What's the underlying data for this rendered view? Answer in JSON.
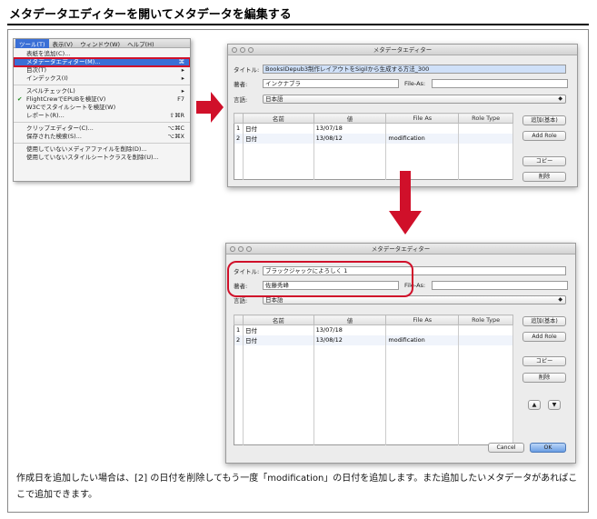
{
  "page_title": "メタデータエディターを開いてメタデータを編集する",
  "menu": {
    "bar": [
      "ツール(T)",
      "表示(V)",
      "ウィンドウ(W)",
      "ヘルプ(H)"
    ],
    "items": [
      {
        "label": "表紙を追加(C)...",
        "shortcut": ""
      },
      {
        "label": "メタデータエディター(M)...",
        "shortcut": "⌘"
      },
      {
        "label": "目次(T)",
        "shortcut": "▸"
      },
      {
        "label": "インデックス(I)",
        "shortcut": "▸"
      },
      {
        "label": "スペルチェック(L)",
        "shortcut": "▸"
      },
      {
        "label": "FlightCrewでEPUBを検証(V)",
        "shortcut": "F7"
      },
      {
        "label": "W3Cでスタイルシートを検証(W)",
        "shortcut": ""
      },
      {
        "label": "レポート(R)...",
        "shortcut": "⇧⌘R"
      },
      {
        "label": "クリップエディター(C)...",
        "shortcut": "⌥⌘C"
      },
      {
        "label": "保存された検索(S)...",
        "shortcut": "⌥⌘X"
      },
      {
        "label": "使用していないメディアファイルを削除(D)...",
        "shortcut": ""
      },
      {
        "label": "使用していないスタイルシートクラスを削除(U)...",
        "shortcut": ""
      }
    ]
  },
  "dialog1": {
    "title": "メタデータエディター",
    "title_label": "タイトル:",
    "title_value": "BooksIDepub3制作レイアウトをSigilから生成する方法_300",
    "author_label": "著者:",
    "author_value": "インクナブラ",
    "fileas_label": "File-As:",
    "fileas_value": "",
    "language_label": "言語:",
    "language_value": "日本語",
    "columns": [
      "名前",
      "値",
      "File As",
      "Role Type"
    ],
    "rows": [
      {
        "num": "1",
        "name": "日付",
        "value": "13/07/18",
        "fileas": "",
        "role": ""
      },
      {
        "num": "2",
        "name": "日付",
        "value": "13/08/12",
        "fileas": "modification",
        "role": ""
      }
    ],
    "buttons": {
      "add_basic": "追加(基本)",
      "add_role": "Add Role",
      "copy": "コピー",
      "delete": "削除"
    }
  },
  "dialog2": {
    "title": "メタデータエディター",
    "title_label": "タイトル:",
    "title_value": "ブラックジャックによろしく 1",
    "author_label": "著者:",
    "author_value": "佐藤秀峰",
    "fileas_label": "File-As:",
    "fileas_value": "",
    "language_label": "言語:",
    "language_value": "日本語",
    "columns": [
      "名前",
      "値",
      "File As",
      "Role Type"
    ],
    "rows": [
      {
        "num": "1",
        "name": "日付",
        "value": "13/07/18",
        "fileas": "",
        "role": ""
      },
      {
        "num": "2",
        "name": "日付",
        "value": "13/08/12",
        "fileas": "modification",
        "role": ""
      }
    ],
    "buttons": {
      "add_basic": "追加(基本)",
      "add_role": "Add Role",
      "copy": "コピー",
      "delete": "削除",
      "up": "▲",
      "down": "▼",
      "cancel": "Cancel",
      "ok": "OK"
    }
  },
  "caption": "作成日を追加したい場合は、[2] の日付を削除してもう一度「modification」の日付を追加します。また追加したいメタデータがあればここで追加できます。",
  "colors": {
    "accent_red": "#d0102a",
    "selection_blue": "#3a6fd6"
  }
}
